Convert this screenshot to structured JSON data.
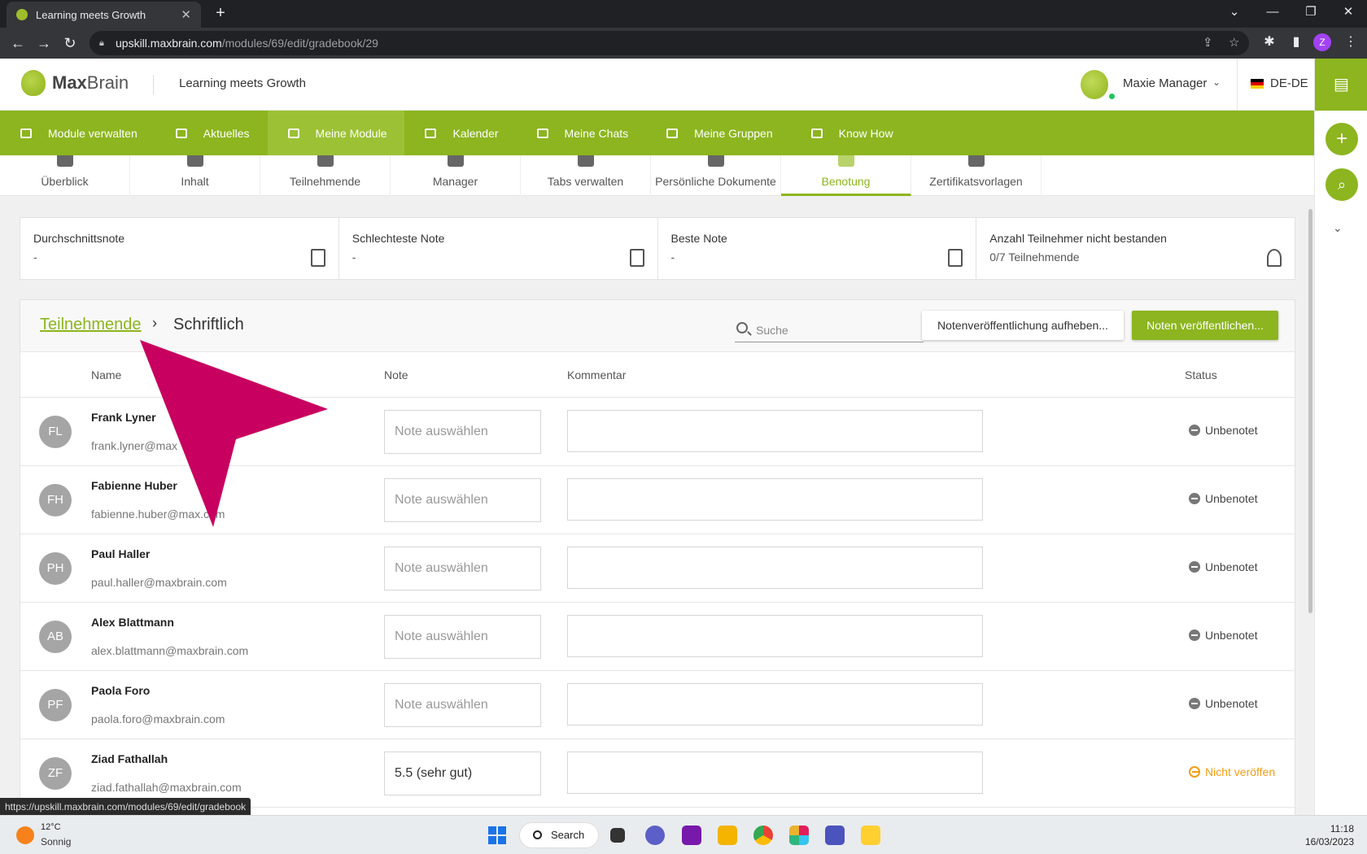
{
  "browser": {
    "tab_title": "Learning meets Growth",
    "tab_close": "✕",
    "new_tab": "+",
    "url_host": "upskill.maxbrain.com",
    "url_path": "/modules/69/edit/gradebook/29",
    "profile_initial": "Z",
    "status_url": "https://upskill.maxbrain.com/modules/69/edit/gradebook"
  },
  "header": {
    "logo_max": "Max",
    "logo_brain": "Brain",
    "tagline": "Learning meets Growth",
    "user_name": "Maxie Manager",
    "language": "DE-DE"
  },
  "main_nav": [
    {
      "label": "Module verwalten"
    },
    {
      "label": "Aktuelles"
    },
    {
      "label": "Meine Module"
    },
    {
      "label": "Kalender"
    },
    {
      "label": "Meine Chats"
    },
    {
      "label": "Meine Gruppen"
    },
    {
      "label": "Know How"
    }
  ],
  "sub_tabs": [
    {
      "label": "Überblick"
    },
    {
      "label": "Inhalt"
    },
    {
      "label": "Teilnehmende"
    },
    {
      "label": "Manager"
    },
    {
      "label": "Tabs verwalten"
    },
    {
      "label": "Persönliche Dokumente"
    },
    {
      "label": "Benotung"
    },
    {
      "label": "Zertifikatsvorlagen"
    }
  ],
  "stats": [
    {
      "label": "Durchschnittsnote",
      "value": "-"
    },
    {
      "label": "Schlechteste Note",
      "value": "-"
    },
    {
      "label": "Beste Note",
      "value": "-"
    },
    {
      "label": "Anzahl Teilnehmer nicht bestanden",
      "value": "0/7 Teilnehmende"
    }
  ],
  "gradebook": {
    "breadcrumb_link": "Teilnehmende",
    "breadcrumb_sep": "›",
    "breadcrumb_current": "Schriftlich",
    "search_placeholder": "Suche",
    "unpublish_label": "Notenveröffentlichung aufheben...",
    "publish_label": "Noten veröffentlichen...",
    "columns": {
      "name": "Name",
      "grade": "Note",
      "comment": "Kommentar",
      "status": "Status"
    },
    "rows": [
      {
        "initials": "FL",
        "name": "Frank Lyner",
        "email": "frank.lyner@max",
        "grade": "Note auswählen",
        "status": "Unbenotet"
      },
      {
        "initials": "FH",
        "name": "Fabienne Huber",
        "email": "fabienne.huber@max.com",
        "grade": "Note auswählen",
        "status": "Unbenotet"
      },
      {
        "initials": "PH",
        "name": "Paul Haller",
        "email": "paul.haller@maxbrain.com",
        "grade": "Note auswählen",
        "status": "Unbenotet"
      },
      {
        "initials": "AB",
        "name": "Alex Blattmann",
        "email": "alex.blattmann@maxbrain.com",
        "grade": "Note auswählen",
        "status": "Unbenotet"
      },
      {
        "initials": "PF",
        "name": "Paola Foro",
        "email": "paola.foro@maxbrain.com",
        "grade": "Note auswählen",
        "status": "Unbenotet"
      },
      {
        "initials": "ZF",
        "name": "Ziad Fathallah",
        "email": "ziad.fathallah@maxbrain.com",
        "grade": "5.5 (sehr gut)",
        "status": "Nicht veröffen"
      }
    ]
  },
  "taskbar": {
    "temp": "12°C",
    "weather": "Sonnig",
    "search_label": "Search",
    "time": "11:18",
    "date": "16/03/2023"
  },
  "colors": {
    "brand_green": "#8cb51f",
    "annotation_arrow": "#c8005f",
    "warning": "#f39c12"
  }
}
